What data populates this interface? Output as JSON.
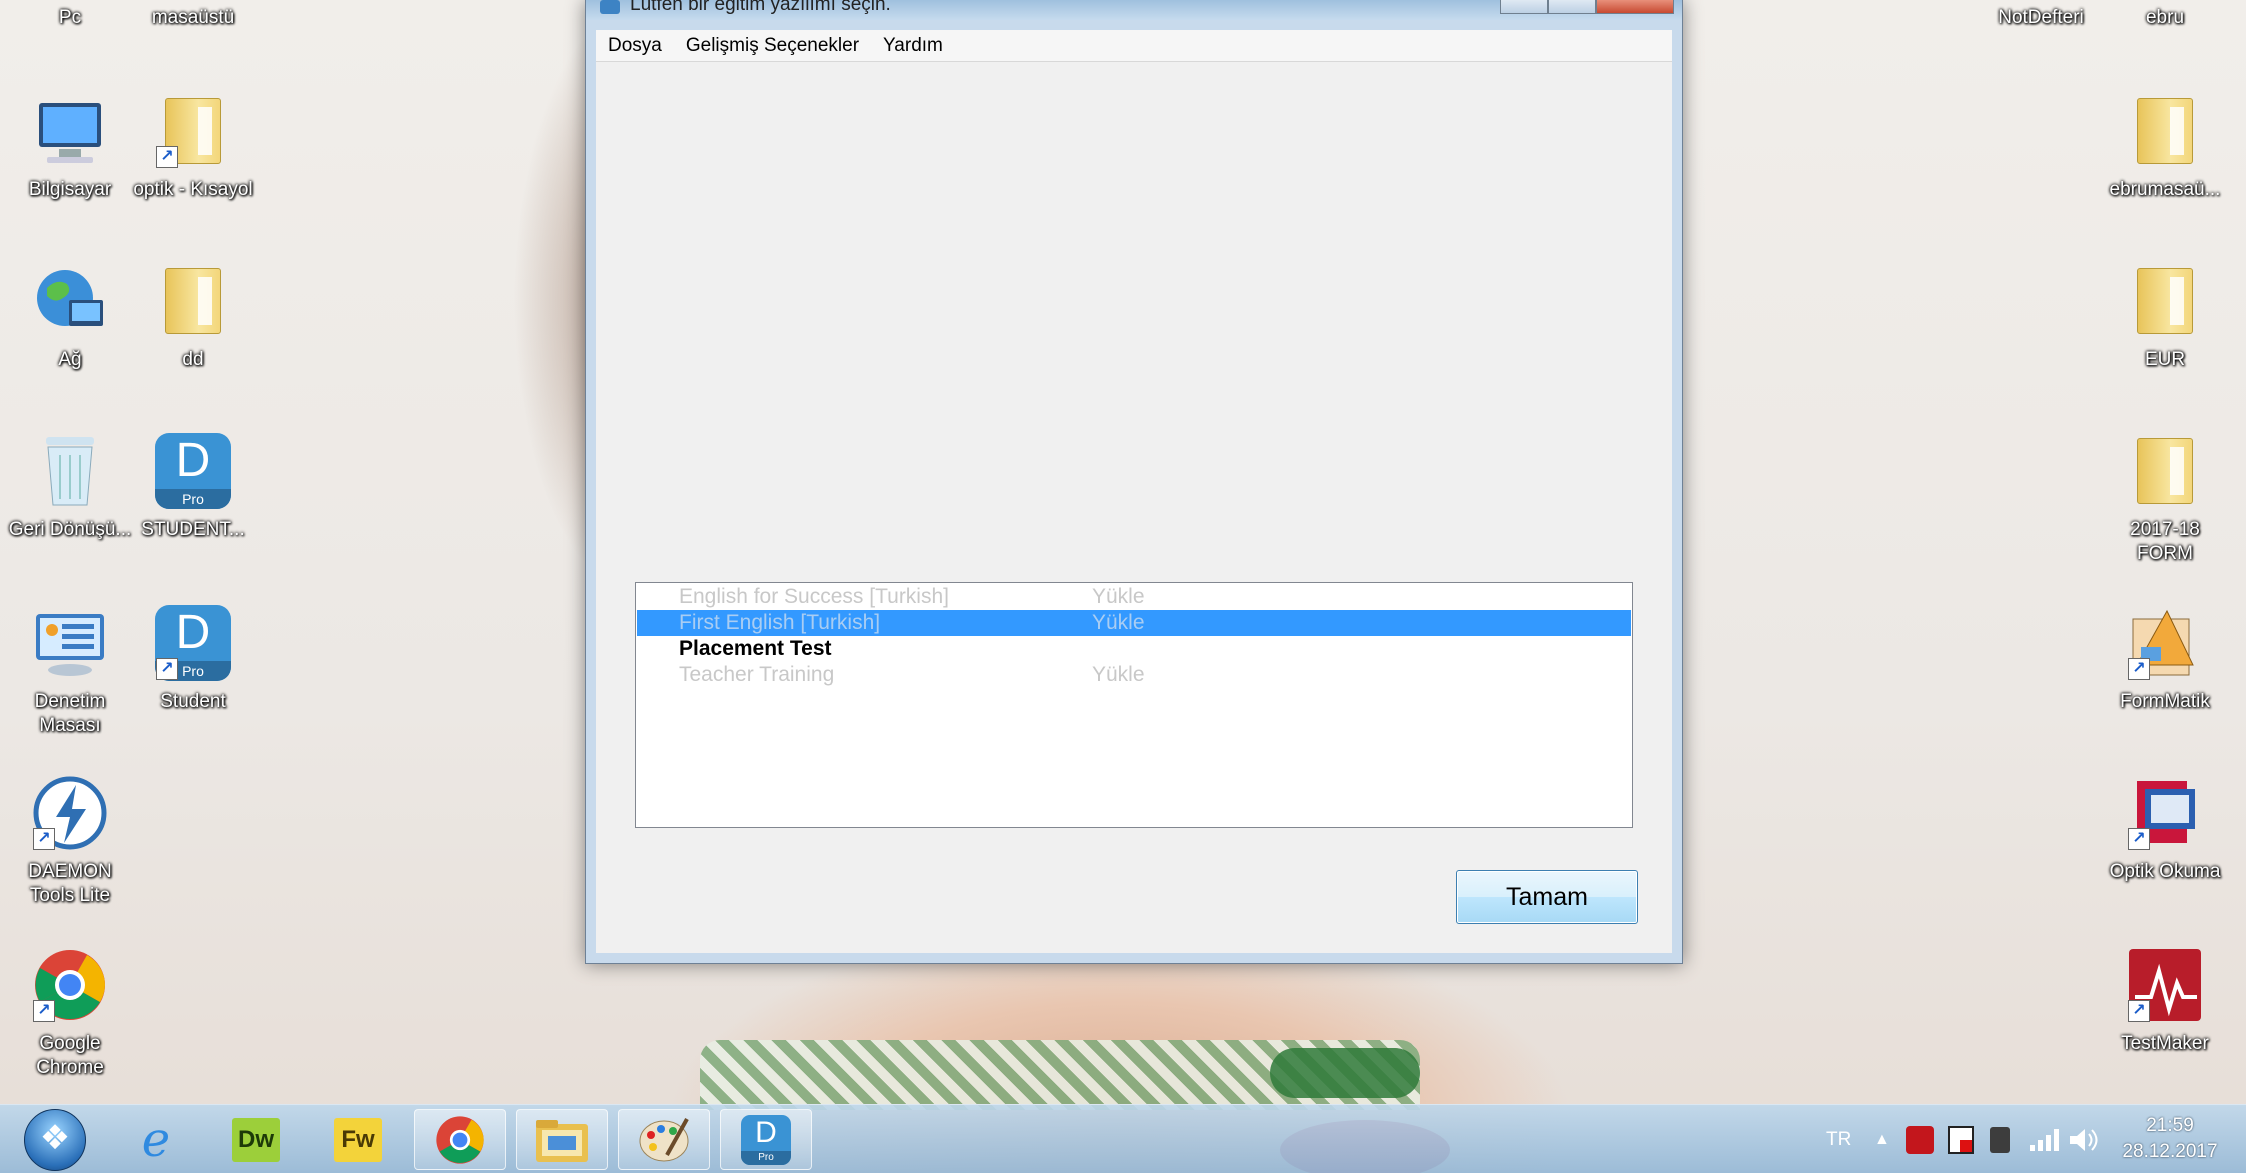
{
  "desktop": {
    "left_icons": [
      {
        "label": "Pc",
        "icon": "computer-partial"
      },
      {
        "label": "masaüstü",
        "icon": "folder-partial"
      },
      {
        "label": "Bilgisayar",
        "icon": "computer-icon"
      },
      {
        "label": "optik - Kısayol",
        "icon": "folder-shortcut-icon"
      },
      {
        "label": "Ağ",
        "icon": "network-globe-icon"
      },
      {
        "label": "dd",
        "icon": "folder-icon"
      },
      {
        "label": "Geri Dönüşü...",
        "icon": "recycle-bin-icon"
      },
      {
        "label": "STUDENT...",
        "icon": "dpro-app-icon"
      },
      {
        "label": "Denetim Masası",
        "icon": "control-panel-icon"
      },
      {
        "label": "Student",
        "icon": "dpro-app-shortcut-icon"
      },
      {
        "label": "DAEMON Tools Lite",
        "icon": "daemon-tools-icon"
      },
      {
        "label": "Google Chrome",
        "icon": "chrome-icon"
      }
    ],
    "right_icons": [
      {
        "label": "NotDefteri",
        "icon": "notepad-partial"
      },
      {
        "label": "ebru",
        "icon": "folder-partial"
      },
      {
        "label": "ebrumasaü...",
        "icon": "folder-icon"
      },
      {
        "label": "EUR",
        "icon": "folder-icon"
      },
      {
        "label": "2017-18 FORM",
        "icon": "folder-icon"
      },
      {
        "label": "FormMatik",
        "icon": "formmatik-icon"
      },
      {
        "label": "Optik Okuma",
        "icon": "optik-okuma-icon"
      },
      {
        "label": "TestMaker",
        "icon": "testmaker-icon"
      }
    ]
  },
  "window": {
    "title": "Lütfen bir eğitim yazılımı seçin.",
    "menu": [
      "Dosya",
      "Gelişmiş Seçenekler",
      "Yardım"
    ],
    "list": [
      {
        "name": "English for Success  [Turkish]",
        "action": "Yükle",
        "state": "disabled"
      },
      {
        "name": "First English  [Turkish]",
        "action": "Yükle",
        "state": "selected"
      },
      {
        "name": "Placement Test",
        "action": "",
        "state": "bold"
      },
      {
        "name": "Teacher Training",
        "action": "Yükle",
        "state": "disabled"
      }
    ],
    "ok_label": "Tamam"
  },
  "taskbar": {
    "apps": [
      {
        "name": "internet-explorer",
        "label": "e"
      },
      {
        "name": "dreamweaver",
        "label": "Dw"
      },
      {
        "name": "fireworks",
        "label": "Fw"
      },
      {
        "name": "chrome",
        "label": ""
      },
      {
        "name": "file-explorer",
        "label": ""
      },
      {
        "name": "paint",
        "label": ""
      },
      {
        "name": "dpro",
        "label": "D"
      }
    ],
    "language": "TR",
    "time": "21:59",
    "date": "28.12.2017"
  }
}
